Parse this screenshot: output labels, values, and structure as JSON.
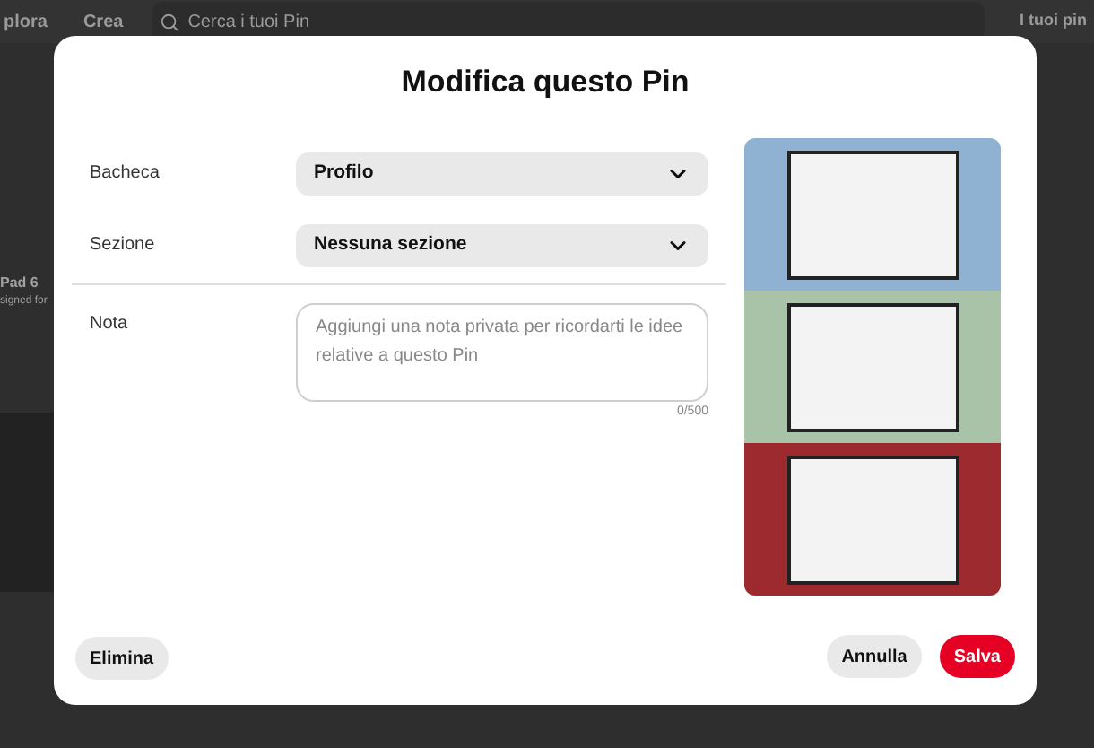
{
  "background": {
    "nav": [
      {
        "label": "plora"
      },
      {
        "label": "Crea"
      }
    ],
    "search": {
      "placeholder": "Cerca i tuoi Pin"
    },
    "account_menu": "I tuoi pin",
    "card_texts": [
      "Pad 6",
      "signed for"
    ]
  },
  "dialog": {
    "title": "Modifica questo Pin",
    "fields": [
      {
        "kind": "select",
        "label": "Bacheca",
        "value": "Profilo"
      },
      {
        "kind": "select",
        "label": "Sezione",
        "value": "Nessuna sezione"
      },
      {
        "kind": "textarea",
        "label": "Nota",
        "placeholder": "Aggiungi una nota privata per ricordarti le idee relative a questo Pin",
        "counter": "0/500"
      }
    ],
    "buttons": [
      {
        "label": "Elimina",
        "kind": "secondary"
      },
      {
        "label": "Annulla",
        "kind": "secondary"
      },
      {
        "label": "Salva",
        "kind": "primary"
      }
    ]
  }
}
